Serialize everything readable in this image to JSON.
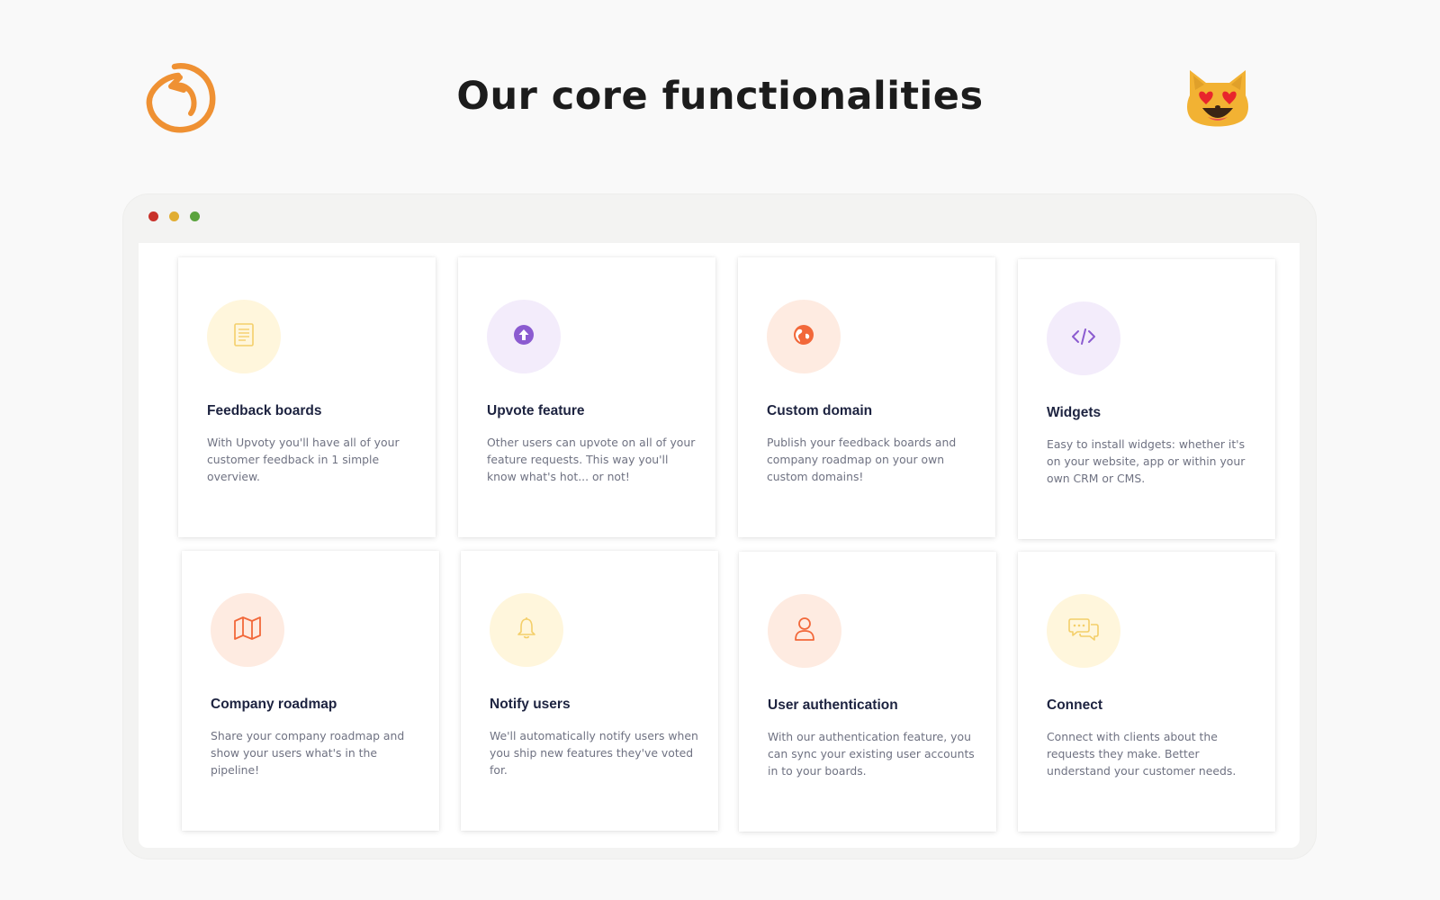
{
  "header": {
    "title": "Our core functionalities",
    "logo_icon": "upvoty-logo-icon",
    "emoji_icon": "heart-eyes-cat-icon"
  },
  "browser": {
    "window_dots": [
      "#c8312a",
      "#e1ad32",
      "#5aa33d"
    ]
  },
  "colors": {
    "brand_orange": "#ef9133",
    "title_text": "#1d2340",
    "body_text": "#6f7282"
  },
  "features": [
    {
      "title": "Feedback boards",
      "description": "With Upvoty you'll have all of your customer feedback in 1 simple overview.",
      "icon": "document-icon",
      "circle_bg": "#fff6dc",
      "icon_color": "#f4cf6a"
    },
    {
      "title": "Upvote feature",
      "description": "Other users can upvote on all of your feature requests. This way you'll know what's hot... or not!",
      "icon": "upvote-arrow-icon",
      "circle_bg": "#f3ecfb",
      "icon_color": "#8b5bd0"
    },
    {
      "title": "Custom domain",
      "description": "Publish your feedback boards and company roadmap on your own custom domains!",
      "icon": "globe-icon",
      "circle_bg": "#feebe1",
      "icon_color": "#f2683a"
    },
    {
      "title": "Widgets",
      "description": "Easy to install widgets: whether it's on your website, app or within your own CRM or CMS.",
      "icon": "code-icon",
      "circle_bg": "#f3ecfb",
      "icon_color": "#8b5bd0"
    },
    {
      "title": "Company roadmap",
      "description": "Share your company roadmap and show your users what's in the pipeline!",
      "icon": "map-icon",
      "circle_bg": "#feebe1",
      "icon_color": "#f2683a"
    },
    {
      "title": "Notify users",
      "description": "We'll automatically notify users when you ship new features they've voted for.",
      "icon": "bell-icon",
      "circle_bg": "#fff6dc",
      "icon_color": "#f4cf6a"
    },
    {
      "title": "User authentication",
      "description": "With our authentication feature, you can sync your existing user accounts in to your boards.",
      "icon": "user-icon",
      "circle_bg": "#feebe1",
      "icon_color": "#f2683a"
    },
    {
      "title": "Connect",
      "description": "Connect with clients about the requests they make. Better understand your customer needs.",
      "icon": "chat-bubbles-icon",
      "circle_bg": "#fff6dc",
      "icon_color": "#f4cf6a"
    }
  ]
}
